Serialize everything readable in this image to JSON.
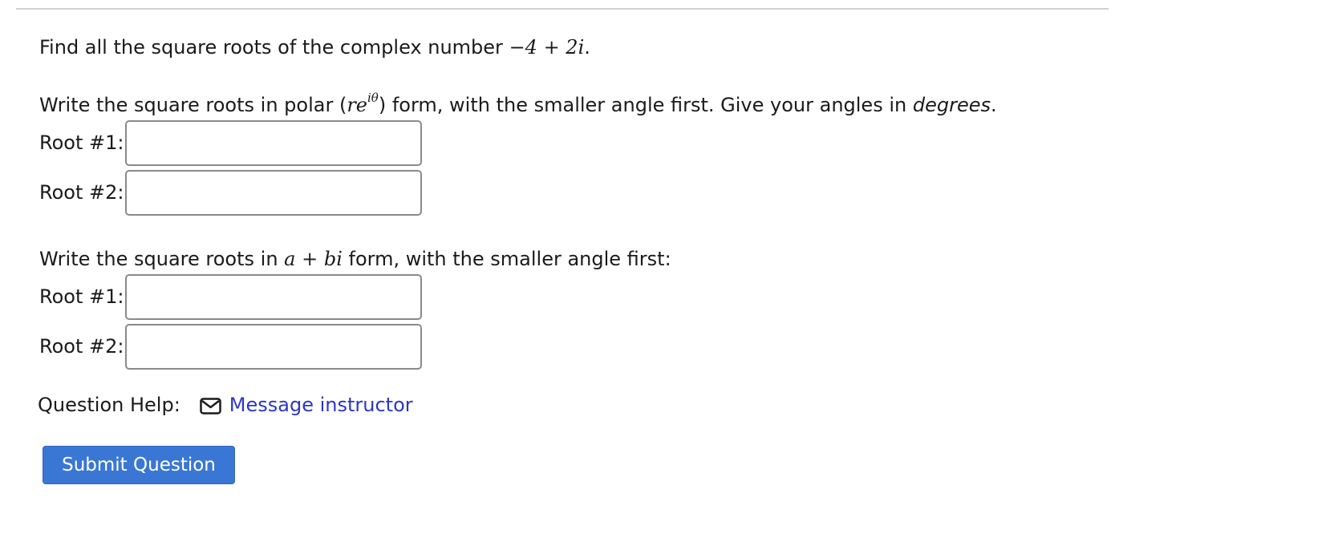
{
  "question": {
    "prompt_text": "Find all the square roots of the complex number",
    "prompt_math": "−4 + 2i",
    "prompt_end": ".",
    "polar_text_1": "Write the square roots in polar (",
    "polar_math_base": "re",
    "polar_math_exp": "iθ",
    "polar_text_2": ") form, with the smaller angle first. Give your angles in ",
    "polar_text_em": "degrees",
    "polar_text_3": ".",
    "rect_text_1": "Write the square roots in ",
    "rect_math": "a + bi",
    "rect_text_2": " form, with the smaller angle first:"
  },
  "polar_roots": [
    {
      "label": "Root #1:",
      "value": ""
    },
    {
      "label": "Root #2:",
      "value": ""
    }
  ],
  "rect_roots": [
    {
      "label": "Root #1:",
      "value": ""
    },
    {
      "label": "Root #2:",
      "value": ""
    }
  ],
  "help": {
    "label": "Question Help:",
    "icon": "mail-icon",
    "link_text": "Message instructor"
  },
  "submit": {
    "label": "Submit Question"
  },
  "colors": {
    "link": "#2a36c9",
    "button_bg": "#3a77d4",
    "rule": "#d0d0d0"
  }
}
